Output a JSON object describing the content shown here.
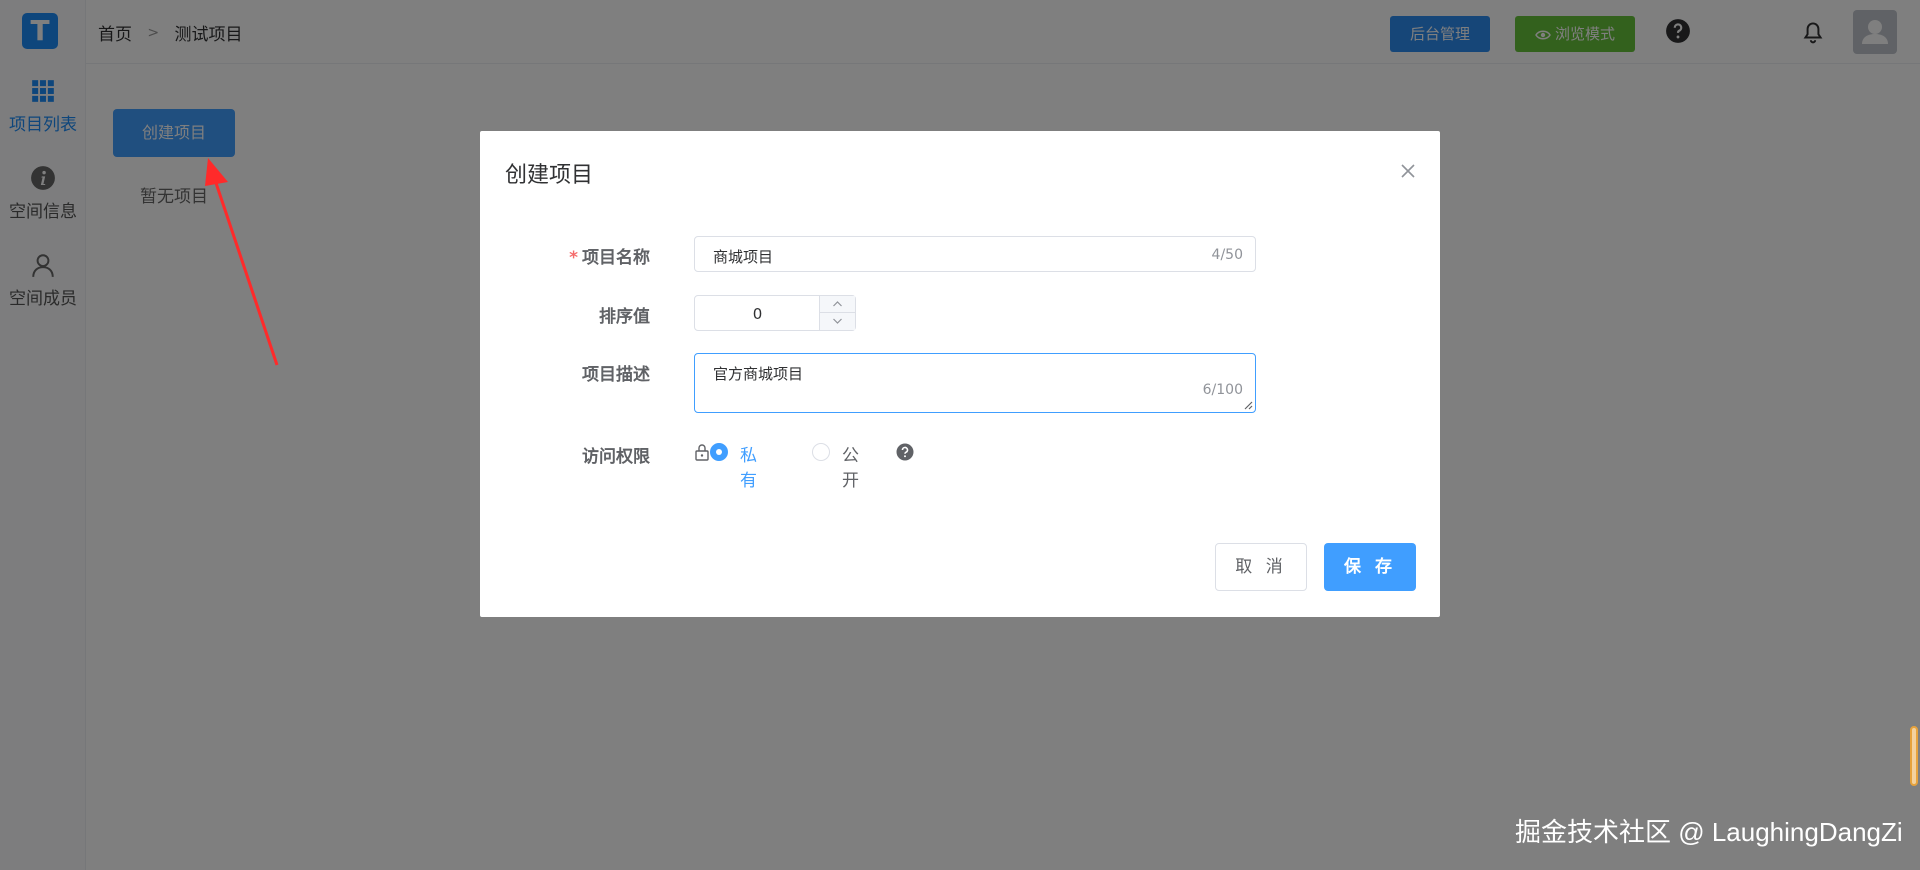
{
  "logo": {
    "letter": "T"
  },
  "sidebar": {
    "items": [
      {
        "label": "项目列表",
        "icon": "grid-icon",
        "active": true
      },
      {
        "label": "空间信息",
        "icon": "info-icon",
        "active": false
      },
      {
        "label": "空间成员",
        "icon": "user-icon",
        "active": false
      }
    ]
  },
  "breadcrumb": {
    "home": "首页",
    "separator": ">",
    "current": "测试项目"
  },
  "header": {
    "admin_label": "后台管理",
    "browse_label": "浏览模式",
    "browse_icon": "eye-icon"
  },
  "page": {
    "create_button": "创建项目",
    "empty_text": "暂无项目"
  },
  "dialog": {
    "title": "创建项目",
    "fields": {
      "name": {
        "required_mark": "*",
        "label": "项目名称",
        "value": "商城项目",
        "count": "4/50"
      },
      "sort": {
        "label": "排序值",
        "value": "0"
      },
      "description": {
        "label": "项目描述",
        "value": "官方商城项目",
        "count": "6/100"
      },
      "permission": {
        "label": "访问权限",
        "options": [
          "私有",
          "公开"
        ],
        "selected": "私有"
      }
    },
    "cancel_label": "取 消",
    "save_label": "保 存"
  },
  "watermark": "掘金技术社区 @ LaughingDangZi",
  "colors": {
    "primary": "#409eff",
    "success": "#67c23a",
    "danger": "#f56c6c",
    "annotation_arrow": "#ff2a2a"
  }
}
